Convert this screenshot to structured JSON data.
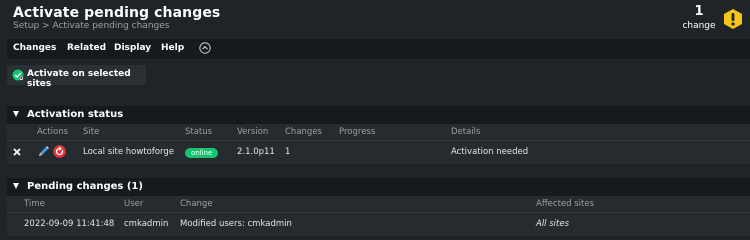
{
  "header": {
    "title": "Activate pending changes",
    "breadcrumb": "Setup > Activate pending changes",
    "change_count": "1",
    "change_label": "change"
  },
  "menu": [
    "Changes",
    "Related",
    "Display",
    "Help"
  ],
  "action_button": {
    "label": "Activate on selected sites"
  },
  "activation_status": {
    "title": "Activation status",
    "columns": [
      "Actions",
      "Site",
      "Status",
      "Version",
      "Changes",
      "Progress",
      "Details"
    ],
    "rows": [
      {
        "site": "Local site howtoforge",
        "status": "online",
        "version": "2.1.0p11",
        "changes": "1",
        "progress": "",
        "details": "Activation needed"
      }
    ]
  },
  "pending_changes": {
    "title": "Pending changes (1)",
    "columns": [
      "Time",
      "User",
      "Change",
      "Affected sites"
    ],
    "rows": [
      {
        "time": "2022-09-09 11:41:48",
        "user": "cmkadmin",
        "change": "Modified users: cmkadmin",
        "affected_sites": "All sites"
      }
    ]
  },
  "colors": {
    "background": "#1f2428",
    "bar": "#161a1d",
    "online_badge": "#14c46f",
    "warning": "#f5c518",
    "danger": "#e0323c"
  }
}
